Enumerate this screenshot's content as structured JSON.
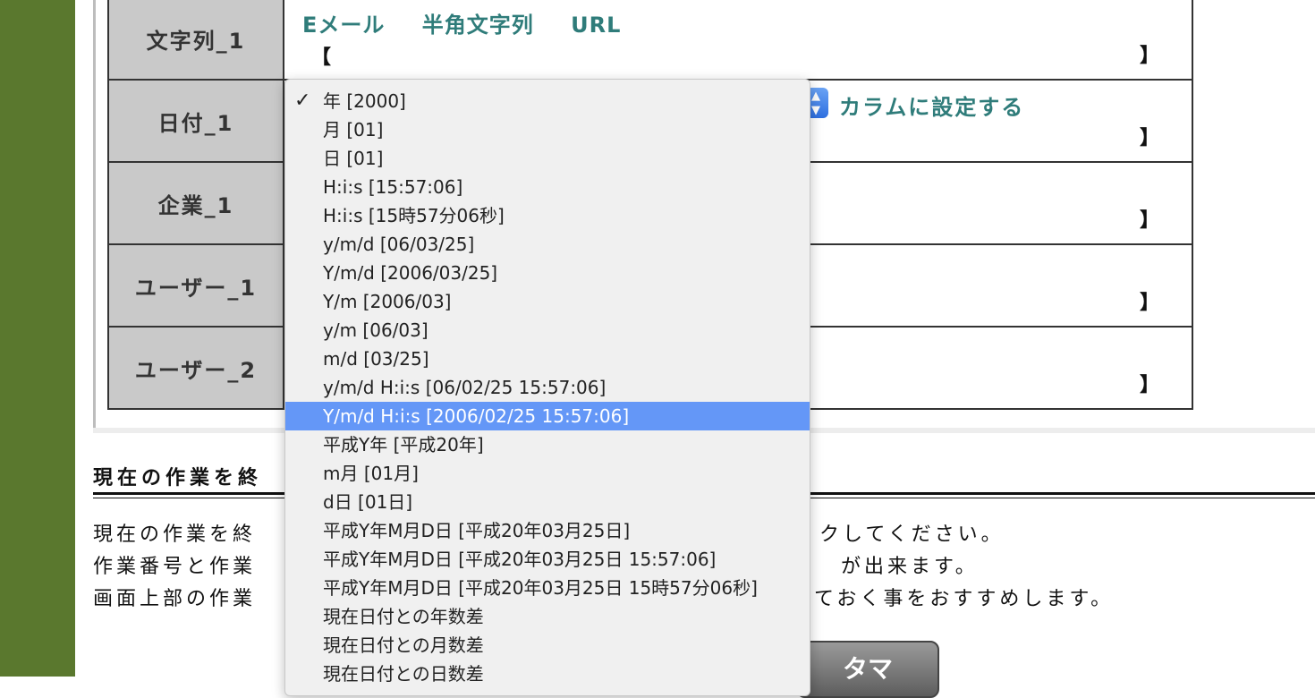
{
  "rows": [
    {
      "label": "文字列_1",
      "types": [
        "Eメール",
        "半角文字列",
        "URL"
      ],
      "open_bracket": "【",
      "close_bracket": "】"
    },
    {
      "label": "日付_1",
      "apply_label": "カラムに設定する",
      "close_bracket": "】"
    },
    {
      "label": "企業_1",
      "close_bracket": "】"
    },
    {
      "label": "ユーザー_1",
      "close_bracket": "】"
    },
    {
      "label": "ユーザー_2",
      "close_bracket": "】"
    }
  ],
  "section": {
    "title": "現在の作業を終",
    "lines": [
      {
        "start": "現在の作業を終",
        "end": "クしてください。"
      },
      {
        "start": "作業番号と作業",
        "end": "が出来ます。"
      },
      {
        "start": "画面上部の作業",
        "end": "ておく事をおすすめします。"
      }
    ]
  },
  "big_button": {
    "label": "タマ"
  },
  "dropdown": {
    "checkmark": "✓",
    "selected_index": 0,
    "highlighted_index": 11,
    "options": [
      "年 [2000]",
      "月 [01]",
      "日 [01]",
      "H:i:s [15:57:06]",
      "H:i:s [15時57分06秒]",
      "y/m/d [06/03/25]",
      "Y/m/d [2006/03/25]",
      "Y/m [2006/03]",
      "y/m [06/03]",
      "m/d [03/25]",
      "y/m/d H:i:s [06/02/25 15:57:06]",
      "Y/m/d H:i:s [2006/02/25 15:57:06]",
      "平成Y年 [平成20年]",
      "m月 [01月]",
      "d日 [01日]",
      "平成Y年M月D日 [平成20年03月25日]",
      "平成Y年M月D日 [平成20年03月25日 15:57:06]",
      "平成Y年M月D日 [平成20年03月25日 15時57分06秒]",
      "現在日付との年数差",
      "現在日付との月数差",
      "現在日付との日数差"
    ]
  },
  "colors": {
    "sidebar": "#5a782e",
    "accent_text": "#2f7c7a",
    "highlight": "#6497f7",
    "label_bg": "#c9c9c9"
  }
}
